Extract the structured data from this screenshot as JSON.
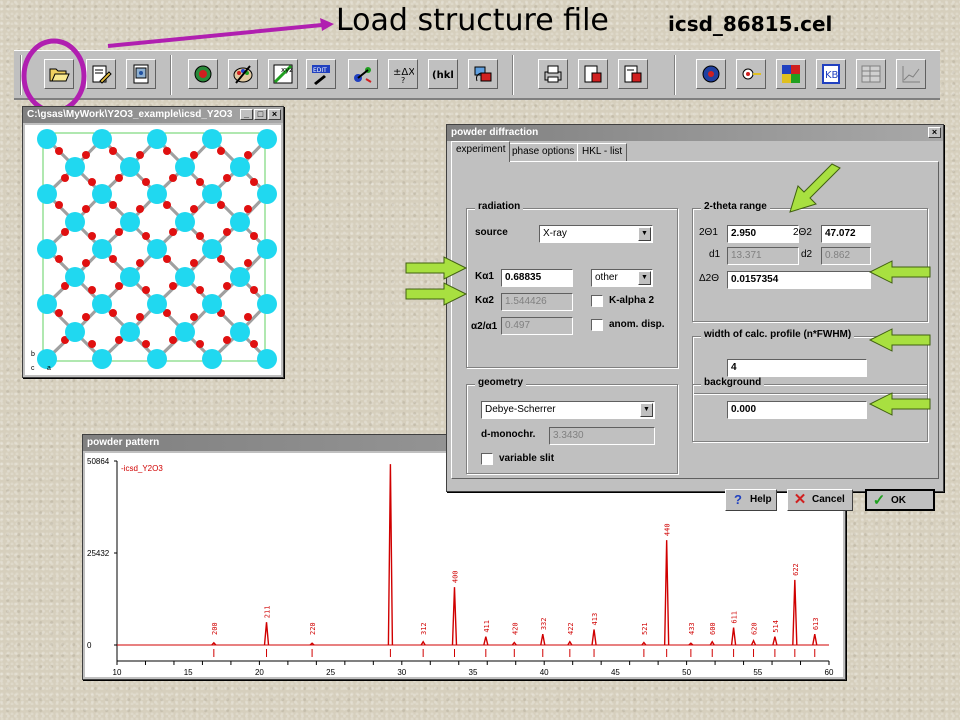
{
  "annotation": {
    "title": "Load structure file",
    "filename": "icsd_86815.cel"
  },
  "toolbar": {
    "buttons": [
      "open-file-icon",
      "edit-structure-icon",
      "calculator-icon",
      "atom-icon",
      "color-palette-icon",
      "xyz-icon",
      "edit-pencil-icon",
      "bond-icon",
      "delta-x-icon",
      "hkl-icon",
      "transform-icon",
      "print-icon",
      "print-preview-icon",
      "export-icon",
      "sphere-icon",
      "link-icon",
      "color-map-icon",
      "kb-icon",
      "table-icon",
      "chart-icon"
    ]
  },
  "structure_window": {
    "title": "C:\\gsas\\MyWork\\Y2O3_example\\icsd_Y2O3",
    "axes": [
      "b",
      "c",
      "a"
    ]
  },
  "dialog": {
    "title": "powder diffraction",
    "tabs": [
      "experiment",
      "phase options",
      "HKL - list"
    ],
    "radiation": {
      "group_title": "radiation",
      "source_label": "source",
      "source_value": "X-ray",
      "ka1_label": "Kα1",
      "ka1_value": "0.68835",
      "ka1_mode": "other",
      "ka2_label": "Kα2",
      "ka2_value": "1.544426",
      "ka_ratio_label": "α2/α1",
      "ka_ratio_value": "0.497",
      "kalpha2_checkbox": "K-alpha 2",
      "anom_checkbox": "anom. disp."
    },
    "two_theta": {
      "group_title": "2-theta range",
      "theta1_label": "2Θ1",
      "theta1_value": "2.950",
      "theta2_label": "2Θ2",
      "theta2_value": "47.072",
      "d1_label": "d1",
      "d1_value": "13.371",
      "d2_label": "d2",
      "d2_value": "0.862",
      "step_label": "Δ2Θ",
      "step_value": "0.0157354"
    },
    "profile": {
      "group_title": "width of calc. profile (n*FWHM)",
      "value": "4"
    },
    "geometry": {
      "group_title": "geometry",
      "value": "Debye-Scherrer",
      "dmono_label": "d-monochr.",
      "dmono_value": "3.3430",
      "variable_slit": "variable slit"
    },
    "background": {
      "group_title": "background",
      "value": "0.000"
    },
    "buttons": {
      "help": "Help",
      "cancel": "Cancel",
      "ok": "OK"
    }
  },
  "pattern_window": {
    "title": "powder pattern",
    "legend": "-icsd_Y2O3",
    "colors": {
      "trace": "#d00000"
    }
  },
  "chart_data": {
    "type": "line",
    "series": [
      {
        "name": "-icsd_Y2O3"
      }
    ],
    "xlim": [
      10,
      60
    ],
    "ylim": [
      0,
      50864
    ],
    "x_ticks": [
      10,
      12,
      14,
      16,
      18,
      20,
      22,
      24,
      26,
      28,
      30,
      32,
      34,
      36,
      38,
      40,
      42,
      44,
      46,
      48,
      50,
      52,
      54,
      56,
      58,
      60
    ],
    "x_tick_labels": [
      "10",
      "15",
      "20",
      "25",
      "30",
      "35",
      "40",
      "45",
      "50",
      "55",
      "60"
    ],
    "x_tick_label_values": [
      10,
      15,
      20,
      25,
      30,
      35,
      40,
      45,
      50,
      55,
      60
    ],
    "y_tick_labels": [
      "50864",
      "25432",
      "0"
    ],
    "y_tick_values": [
      50864,
      25432,
      0
    ],
    "peaks": [
      {
        "x": 16.8,
        "y": 600,
        "label": "200"
      },
      {
        "x": 20.5,
        "y": 6300,
        "label": "211"
      },
      {
        "x": 23.7,
        "y": 500,
        "label": "220"
      },
      {
        "x": 29.2,
        "y": 50000,
        "label": ""
      },
      {
        "x": 31.5,
        "y": 900,
        "label": "312"
      },
      {
        "x": 33.7,
        "y": 16000,
        "label": "400"
      },
      {
        "x": 35.9,
        "y": 2300,
        "label": "411"
      },
      {
        "x": 37.9,
        "y": 700,
        "label": "420"
      },
      {
        "x": 39.9,
        "y": 3000,
        "label": "332"
      },
      {
        "x": 41.8,
        "y": 900,
        "label": "422"
      },
      {
        "x": 43.5,
        "y": 4300,
        "label": "413"
      },
      {
        "x": 47.0,
        "y": 700,
        "label": "521"
      },
      {
        "x": 48.6,
        "y": 29000,
        "label": "440"
      },
      {
        "x": 50.3,
        "y": 500,
        "label": "433"
      },
      {
        "x": 51.8,
        "y": 900,
        "label": "600"
      },
      {
        "x": 53.3,
        "y": 4800,
        "label": "611"
      },
      {
        "x": 54.7,
        "y": 1200,
        "label": "620"
      },
      {
        "x": 56.2,
        "y": 2300,
        "label": "514"
      },
      {
        "x": 57.6,
        "y": 18000,
        "label": "622"
      },
      {
        "x": 59.0,
        "y": 3000,
        "label": "613"
      }
    ]
  }
}
